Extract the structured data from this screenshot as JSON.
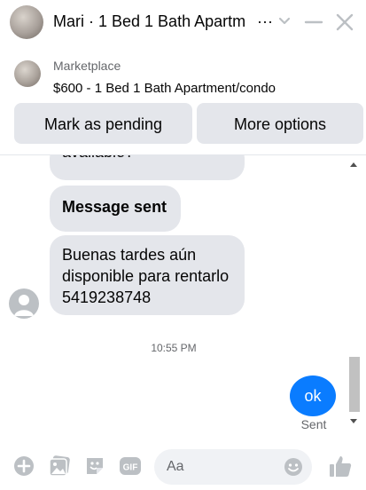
{
  "header": {
    "title": "Mari · 1 Bed 1 Bath Apartm",
    "title_ellipsis": "···"
  },
  "marketplace": {
    "label": "Marketplace",
    "listing": "$600 - 1 Bed 1 Bath Apartment/condo"
  },
  "actions": {
    "pending_label": "Mark as pending",
    "more_label": "More options"
  },
  "messages": [
    {
      "text": "available?"
    },
    {
      "text": "Message sent"
    },
    {
      "text": "Buenas tardes aún disponible para rentarlo 5419238748"
    }
  ],
  "timestamp": "10:55 PM",
  "outgoing": {
    "text": "ok",
    "status": "Sent"
  },
  "composer": {
    "placeholder": "Aa"
  },
  "colors": {
    "accent": "#0a7cff",
    "bubble": "#e4e6eb",
    "icon": "#bcc0c4"
  },
  "icons": {
    "header": [
      "chevron-down-icon",
      "minimize-icon",
      "close-icon"
    ],
    "composer": [
      "plus-icon",
      "image-icon",
      "sticker-icon",
      "gif-icon",
      "emoji-icon",
      "thumbs-up-icon"
    ]
  }
}
